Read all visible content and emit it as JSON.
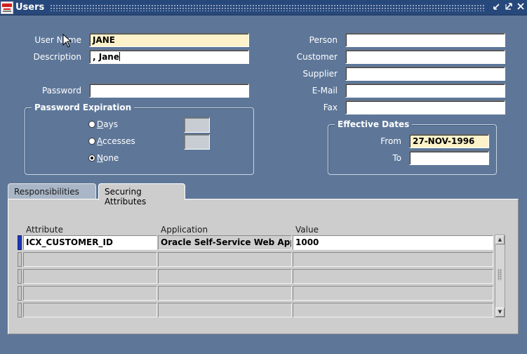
{
  "window": {
    "title": "Users",
    "controls": [
      "restore-down-icon",
      "maximize-icon",
      "close-icon"
    ]
  },
  "user": {
    "user_name_label": "User Name",
    "user_name_value": "JANE",
    "description_label": "Description",
    "description_value": ", Jane",
    "password_label": "Password",
    "password_value": ""
  },
  "password_expiration": {
    "title": "Password Expiration",
    "options": [
      {
        "label": "Days",
        "selected": false,
        "value": ""
      },
      {
        "label": "Accesses",
        "selected": false,
        "value": ""
      },
      {
        "label": "None",
        "selected": true
      }
    ]
  },
  "person": {
    "person_label": "Person",
    "person_value": "",
    "customer_label": "Customer",
    "customer_value": "",
    "supplier_label": "Supplier",
    "supplier_value": "",
    "email_label": "E-Mail",
    "email_value": "",
    "fax_label": "Fax",
    "fax_value": ""
  },
  "effective_dates": {
    "title": "Effective Dates",
    "from_label": "From",
    "from_value": "27-NOV-1996",
    "to_label": "To",
    "to_value": ""
  },
  "tabs": [
    {
      "label": "Responsibilities",
      "active": false
    },
    {
      "label": "Securing Attributes",
      "active": true
    }
  ],
  "table": {
    "columns": [
      "Attribute",
      "Application",
      "Value"
    ],
    "rows": [
      {
        "attribute": "ICX_CUSTOMER_ID",
        "application": "Oracle Self-Service Web Appl",
        "value": "1000"
      },
      {
        "attribute": "",
        "application": "",
        "value": ""
      },
      {
        "attribute": "",
        "application": "",
        "value": ""
      },
      {
        "attribute": "",
        "application": "",
        "value": ""
      },
      {
        "attribute": "",
        "application": "",
        "value": ""
      }
    ]
  },
  "colors": {
    "background": "#5e7799",
    "titlebar": "#27487b",
    "required_field": "#fdf2ca",
    "panel": "#cdcdcd",
    "current_row": "#1e36b6"
  }
}
